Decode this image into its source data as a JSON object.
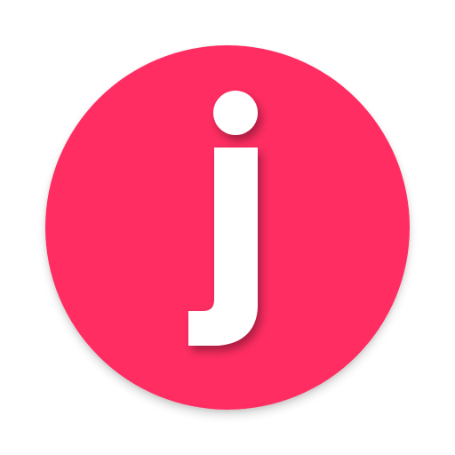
{
  "icon": {
    "letter": "j",
    "background_color": "#FF2D62",
    "glyph_color": "#FFFFFF",
    "shape": "circle"
  }
}
